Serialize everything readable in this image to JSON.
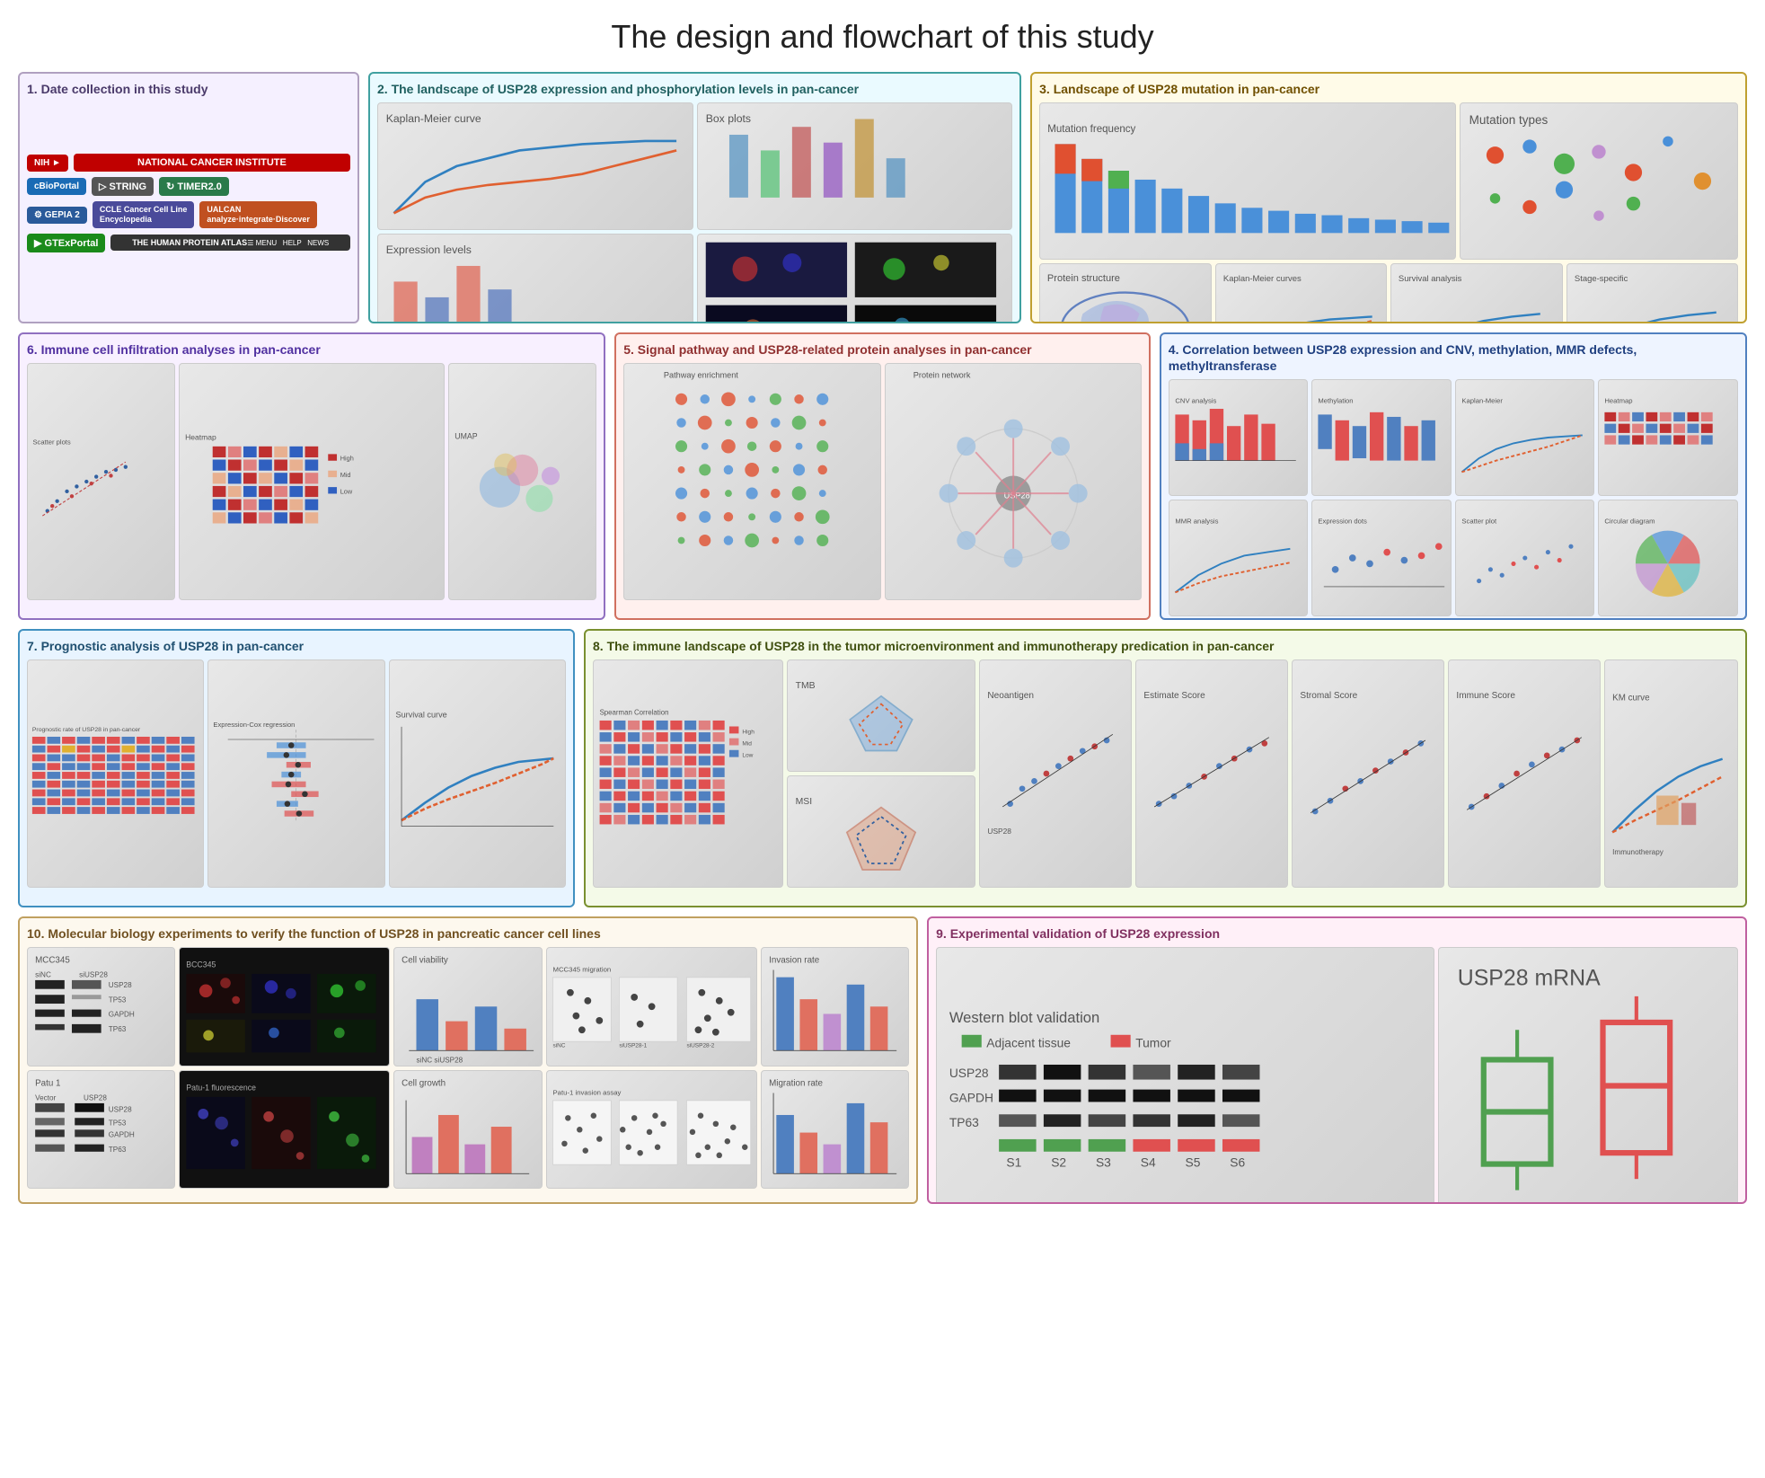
{
  "page": {
    "title": "The design and flowchart of this study"
  },
  "panels": {
    "p1": {
      "number": "1.",
      "title": "Date collection in this study",
      "logos": [
        {
          "label": "NIH",
          "class": "logo-nih"
        },
        {
          "label": "NATIONAL CANCER INSTITUTE",
          "class": "logo-ncibig"
        },
        {
          "label": "cBioPortal",
          "class": "logo-cbio"
        },
        {
          "label": "STRING",
          "class": "logo-string"
        },
        {
          "label": "TIMER2.0",
          "class": "logo-timer"
        },
        {
          "label": "GEPIA 2",
          "class": "logo-gepia"
        },
        {
          "label": "CCLE Cancer Cell Line Encyclopedia",
          "class": "logo-ccle"
        },
        {
          "label": "UALCAN",
          "class": "logo-ualcan"
        },
        {
          "label": "GTExPortal",
          "class": "logo-gtex"
        },
        {
          "label": "THE HUMAN PROTEIN ATLAS",
          "class": "logo-hpa"
        }
      ]
    },
    "p2": {
      "number": "2.",
      "title": "The landscape of USP28 expression and phosphorylation levels in pan-cancer"
    },
    "p3": {
      "number": "3.",
      "title": "Landscape of USP28 mutation in pan-cancer"
    },
    "p4": {
      "number": "4.",
      "title": "Correlation between USP28 expression and CNV, methylation, MMR defects, methyltransferase"
    },
    "p5": {
      "number": "5.",
      "title": "Signal pathway and USP28-related protein analyses in pan-cancer"
    },
    "p6": {
      "number": "6.",
      "title": "Immune cell infiltration analyses in pan-cancer"
    },
    "p7": {
      "number": "7.",
      "title": "Prognostic analysis of  USP28 in pan-cancer"
    },
    "p8": {
      "number": "8.",
      "title": "The immune landscape of USP28 in the tumor microenvironment and immunotherapy predication in pan-cancer"
    },
    "p9": {
      "number": "9.",
      "title": "Experimental validation of USP28 expression"
    },
    "p10": {
      "number": "10.",
      "title": "Molecular biology experiments to verify the function of USP28 in pancreatic cancer cell lines"
    }
  }
}
